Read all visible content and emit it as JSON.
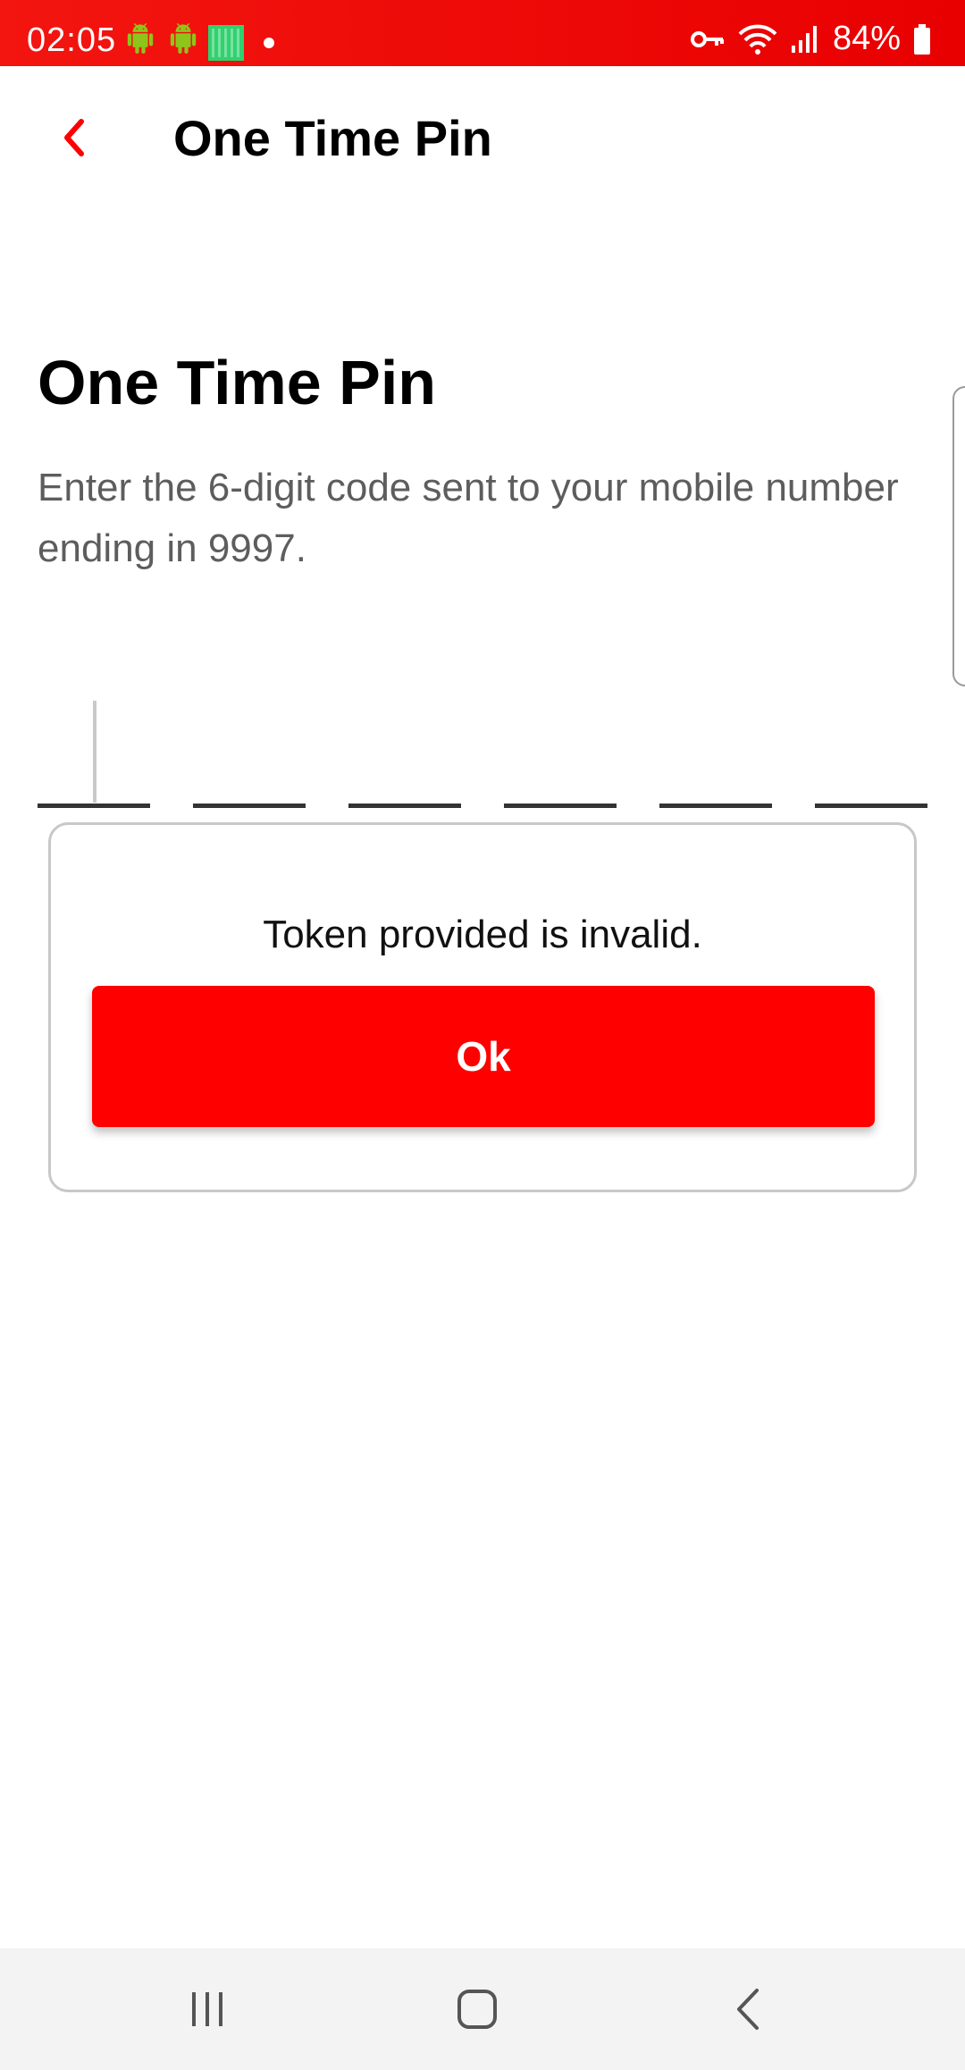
{
  "status_bar": {
    "time": "02:05",
    "battery": "84%",
    "icons": [
      "android-icon",
      "android-icon",
      "app-notification-icon",
      "dot-icon",
      "vpn-key-icon",
      "wifi-icon",
      "signal-icon",
      "battery-icon"
    ]
  },
  "header": {
    "back_icon": "chevron-left-icon",
    "title": "One Time Pin"
  },
  "main": {
    "title": "One Time Pin",
    "instructions": "Enter the 6-digit code sent to your mobile number ending in 9997.",
    "otp_digits": [
      "",
      "",
      "",
      "",
      "",
      ""
    ]
  },
  "dialog": {
    "message": "Token provided is invalid.",
    "ok_label": "Ok"
  },
  "navigation": {
    "buttons": [
      "recent-apps-icon",
      "home-icon",
      "back-icon"
    ]
  },
  "colors": {
    "status_bar": "#e80000",
    "accent": "#ff0000",
    "text_muted": "#5d5d5d"
  }
}
